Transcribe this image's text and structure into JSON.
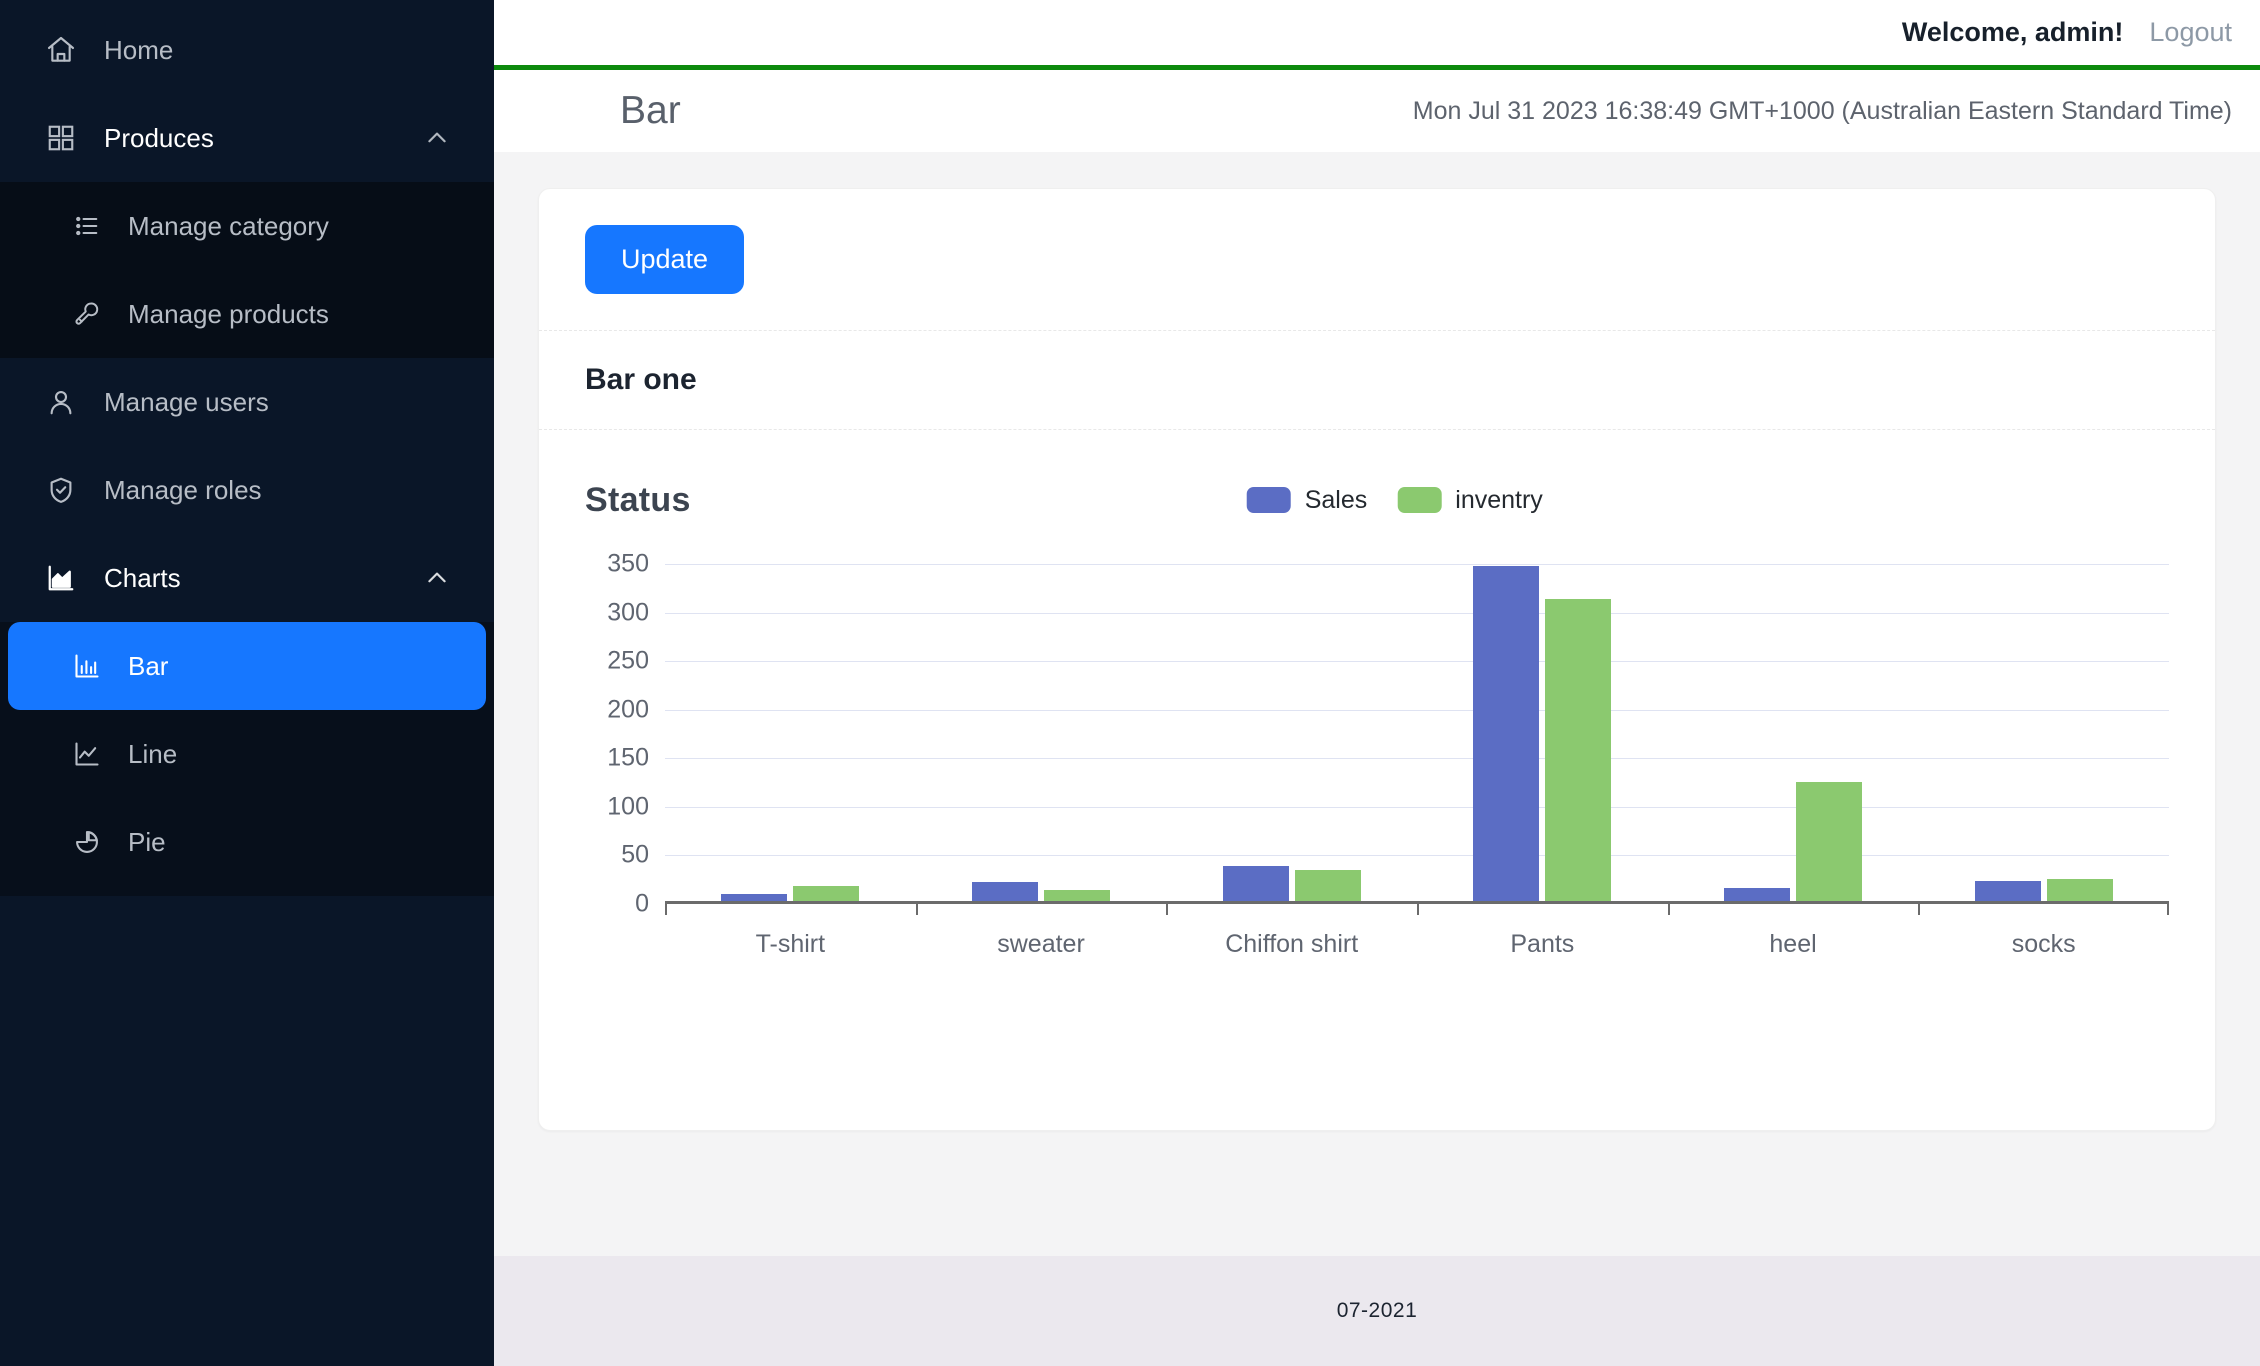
{
  "sidebar": {
    "items": [
      {
        "label": "Home",
        "icon": "home-icon",
        "type": "item"
      },
      {
        "label": "Produces",
        "icon": "grid-icon",
        "type": "group",
        "expanded": true,
        "chevron": "chevron-up-icon"
      },
      {
        "label": "Manage category",
        "icon": "list-icon",
        "type": "sub"
      },
      {
        "label": "Manage products",
        "icon": "wrench-icon",
        "type": "sub"
      },
      {
        "label": "Manage users",
        "icon": "user-icon",
        "type": "item"
      },
      {
        "label": "Manage roles",
        "icon": "shield-check-icon",
        "type": "item"
      },
      {
        "label": "Charts",
        "icon": "area-chart-icon",
        "type": "group",
        "expanded": true,
        "chevron": "chevron-up-icon"
      },
      {
        "label": "Bar",
        "icon": "bar-chart-icon",
        "type": "sub",
        "active": true
      },
      {
        "label": "Line",
        "icon": "line-chart-icon",
        "type": "sub"
      },
      {
        "label": "Pie",
        "icon": "pie-chart-icon",
        "type": "sub"
      }
    ]
  },
  "topbar": {
    "welcome": "Welcome, admin!",
    "logout": "Logout",
    "accent_border": "#0d8a0d"
  },
  "pagehead": {
    "title": "Bar",
    "datetime": "Mon Jul 31 2023 16:38:49 GMT+1000 (Australian Eastern Standard Time)"
  },
  "toolbar": {
    "update_label": "Update",
    "update_color": "#1677ff"
  },
  "card": {
    "subtitle": "Bar one"
  },
  "footer": {
    "text": "07-2021"
  },
  "chart_data": {
    "type": "bar",
    "title": "Status",
    "xlabel": "",
    "ylabel": "",
    "categories": [
      "T-shirt",
      "sweater",
      "Chiffon shirt",
      "Pants",
      "heel",
      "socks"
    ],
    "series": [
      {
        "name": "Sales",
        "color": "#5b6dc4",
        "values": [
          7,
          20,
          36,
          345,
          13,
          21
        ]
      },
      {
        "name": "inventry",
        "color": "#8bc96f",
        "values": [
          15,
          11,
          32,
          311,
          123,
          23
        ]
      }
    ],
    "ylim": [
      0,
      350
    ],
    "yticks": [
      350,
      300,
      250,
      200,
      150,
      100,
      50,
      0
    ],
    "grid": true,
    "legend_position": "top-center"
  }
}
